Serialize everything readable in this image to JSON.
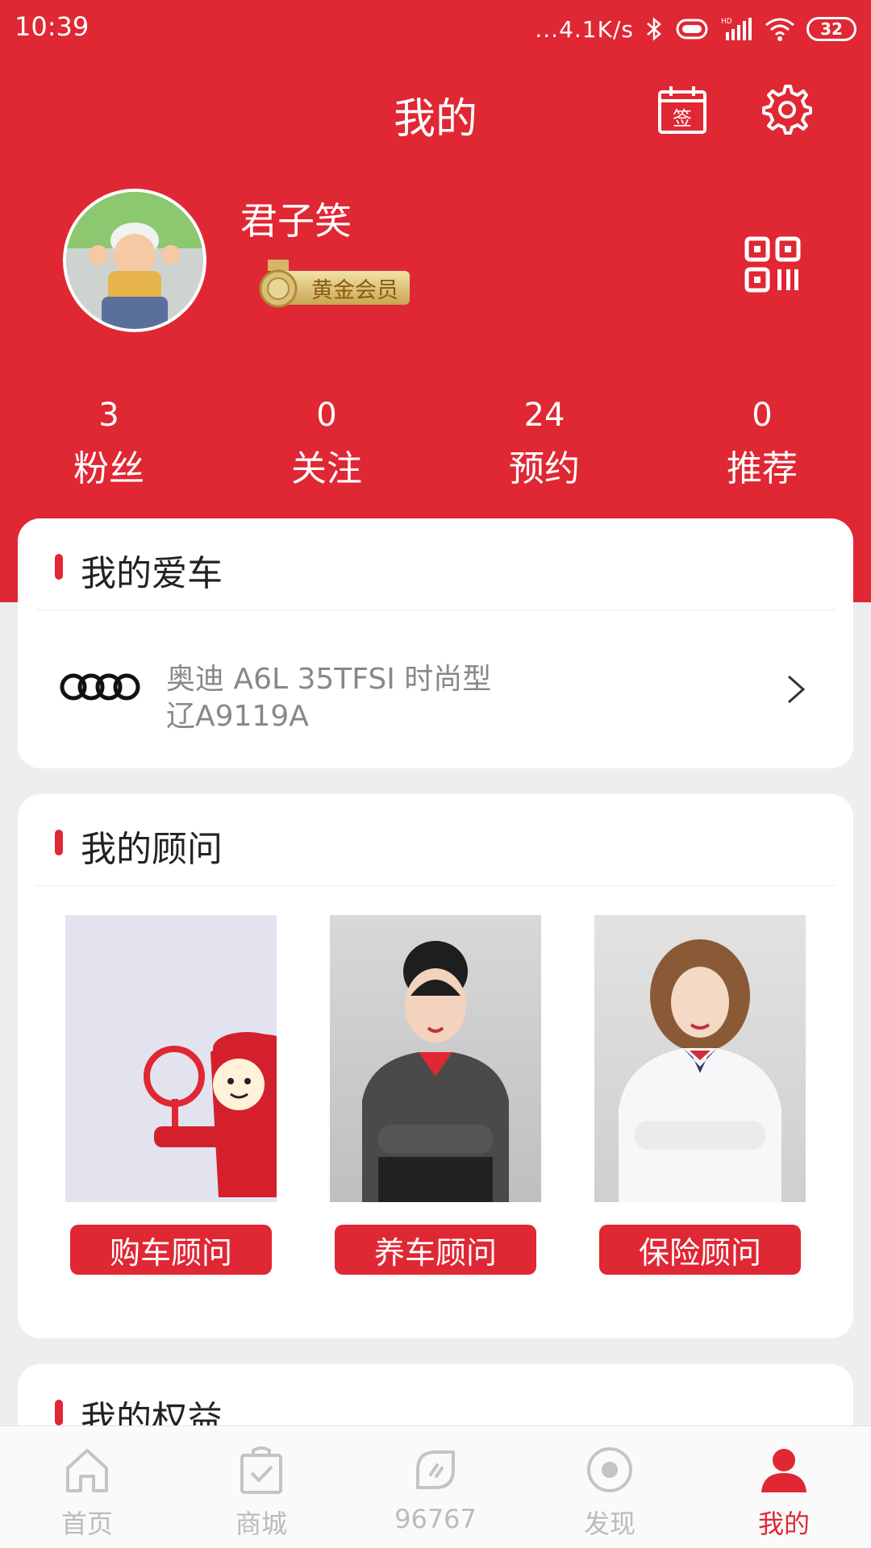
{
  "status_bar": {
    "time": "10:39",
    "net_speed": "...4.1K/s",
    "battery": "32"
  },
  "header": {
    "title": "我的",
    "sign_icon_label": "签",
    "icons": [
      "calendar-sign-icon",
      "gear-icon"
    ]
  },
  "profile": {
    "username": "君子笑",
    "member_level": "黄金会员",
    "icons": [
      "qr-code-icon"
    ]
  },
  "stats": [
    {
      "value": "3",
      "label": "粉丝"
    },
    {
      "value": "0",
      "label": "关注"
    },
    {
      "value": "24",
      "label": "预约"
    },
    {
      "value": "0",
      "label": "推荐"
    }
  ],
  "my_car": {
    "title": "我的爱车",
    "model": "奥迪 A6L 35TFSI 时尚型",
    "plate": "辽A9119A"
  },
  "advisors": {
    "title": "我的顾问",
    "items": [
      {
        "label": "购车顾问"
      },
      {
        "label": "养车顾问"
      },
      {
        "label": "保险顾问"
      }
    ]
  },
  "rights": {
    "title": "我的权益"
  },
  "tabbar": {
    "items": [
      {
        "label": "首页",
        "icon": "home-icon"
      },
      {
        "label": "商城",
        "icon": "shopping-bag-icon"
      },
      {
        "label": "96767",
        "icon": "service-icon"
      },
      {
        "label": "发现",
        "icon": "discover-icon"
      },
      {
        "label": "我的",
        "icon": "user-icon"
      }
    ],
    "active": 4
  },
  "colors": {
    "brand_red": "#e02734",
    "inactive_gray": "#bbbbbb"
  }
}
